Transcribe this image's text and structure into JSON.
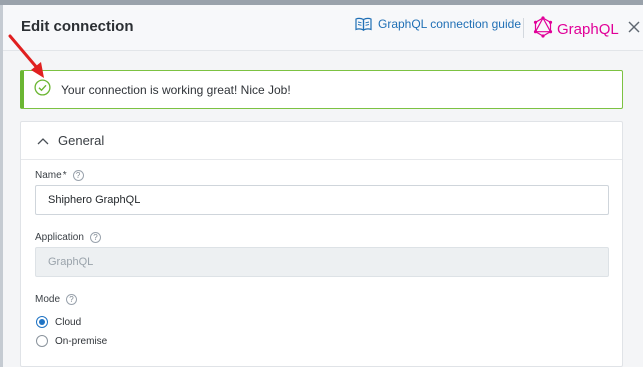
{
  "header": {
    "title": "Edit connection",
    "guide_label": "GraphQL connection guide",
    "brand_name": "GraphQL",
    "brand_color": "#e10098",
    "icons": {
      "guide": "book-icon",
      "brand": "graphql-logo-icon",
      "close": "close-icon"
    }
  },
  "alert": {
    "message": "Your connection is working great! Nice Job!",
    "icon": "check-circle-icon",
    "status_color": "#6bb632"
  },
  "general": {
    "section_title": "General",
    "name": {
      "label": "Name",
      "required_mark": "*",
      "value": "Shiphero GraphQL"
    },
    "application": {
      "label": "Application",
      "value": "GraphQL"
    },
    "mode": {
      "label": "Mode",
      "options": [
        {
          "label": "Cloud",
          "checked": true
        },
        {
          "label": "On-premise",
          "checked": false
        }
      ]
    },
    "help_glyph": "?"
  },
  "annotation": {
    "arrow_color": "#e02020"
  }
}
